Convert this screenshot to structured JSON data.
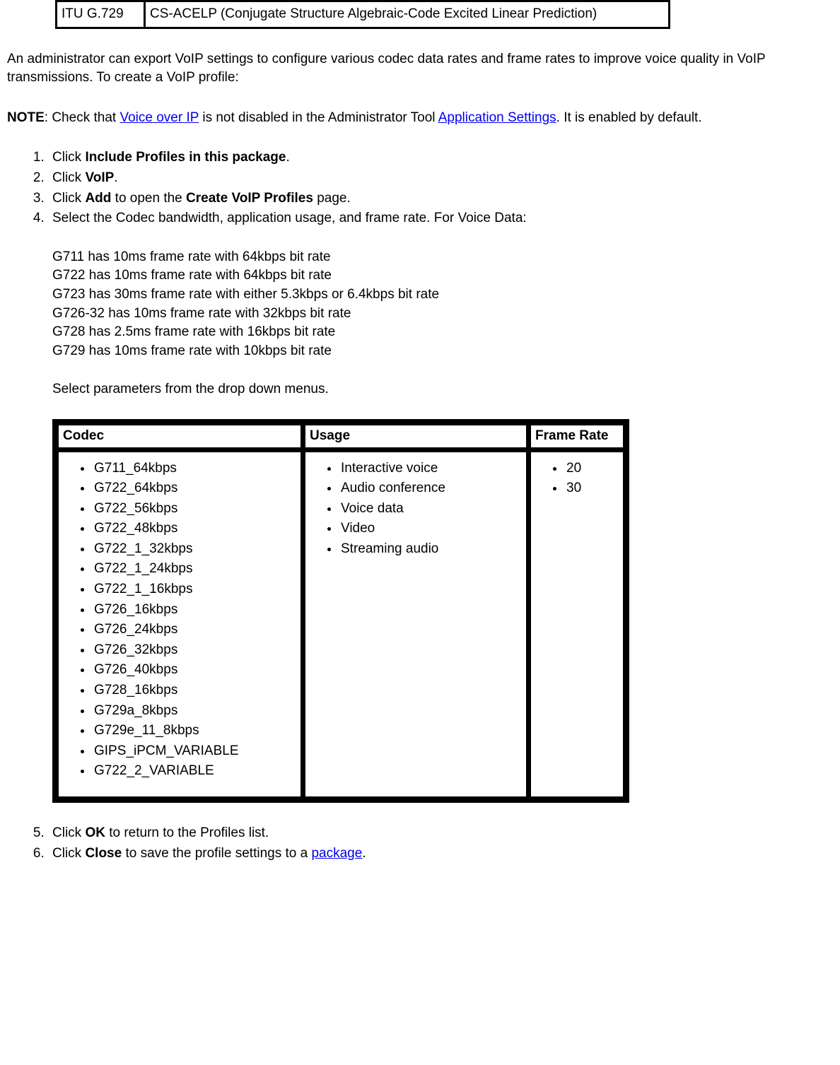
{
  "top_table": {
    "left": "ITU G.729",
    "right": "CS-ACELP (Conjugate Structure Algebraic-Code Excited Linear Prediction)"
  },
  "intro": "An administrator can export VoIP settings to configure various codec data rates and frame rates to improve voice quality in VoIP transmissions. To create a VoIP profile:",
  "note": {
    "label": "NOTE",
    "before_link1": ": Check that ",
    "link1": "Voice over IP",
    "between": " is not disabled in the Administrator Tool ",
    "link2": "Application Settings",
    "after": ". It is enabled by default."
  },
  "steps": {
    "s1_before": "Click ",
    "s1_bold": "Include Profiles in this package",
    "s1_after": ".",
    "s2_before": "Click ",
    "s2_bold": "VoIP",
    "s2_after": ".",
    "s3_before": "Click ",
    "s3_bold1": "Add",
    "s3_mid": " to open the ",
    "s3_bold2": "Create VoIP Profiles",
    "s3_after": " page.",
    "s4": "Select the Codec bandwidth, application usage, and frame rate. For Voice Data:",
    "voice_lines": [
      "G711 has 10ms frame rate with 64kbps bit rate",
      "G722 has 10ms frame rate with 64kbps bit rate",
      "G723 has 30ms frame rate with either 5.3kbps or 6.4kbps bit rate",
      "G726-32 has 10ms frame rate with 32kbps bit rate",
      "G728 has 2.5ms frame rate with 16kbps bit rate",
      "G729 has 10ms frame rate with 10kbps bit rate"
    ],
    "select_params": "Select parameters from the drop down menus.",
    "s5_before": "Click ",
    "s5_bold": "OK",
    "s5_after": " to return to the Profiles list.",
    "s6_before": "Click ",
    "s6_bold": "Close",
    "s6_mid": " to save the profile settings to a ",
    "s6_link": "package",
    "s6_after": "."
  },
  "params_table": {
    "headers": {
      "codec": "Codec",
      "usage": "Usage",
      "frame_rate": "Frame Rate"
    },
    "codec": [
      "G711_64kbps",
      "G722_64kbps",
      "G722_56kbps",
      "G722_48kbps",
      "G722_1_32kbps",
      "G722_1_24kbps",
      "G722_1_16kbps",
      "G726_16kbps",
      "G726_24kbps",
      "G726_32kbps",
      "G726_40kbps",
      "G728_16kbps",
      "G729a_8kbps",
      "G729e_11_8kbps",
      "GIPS_iPCM_VARIABLE",
      "G722_2_VARIABLE"
    ],
    "usage": [
      "Interactive voice",
      "Audio conference",
      "Voice data",
      "Video",
      "Streaming audio"
    ],
    "frame_rate": [
      "20",
      "30"
    ]
  }
}
